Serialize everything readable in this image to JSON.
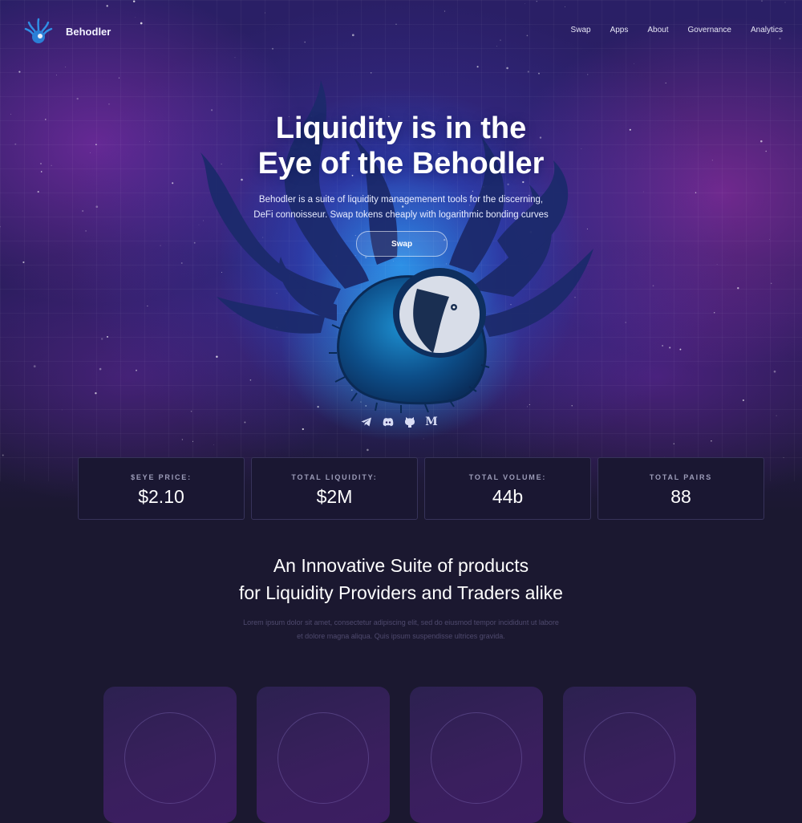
{
  "brand": {
    "name": "Behodler",
    "accent": "#1f78e0"
  },
  "nav": {
    "items": [
      "Swap",
      "Apps",
      "About",
      "Governance",
      "Analytics"
    ]
  },
  "hero": {
    "headline_line1": "Liquidity is in the",
    "headline_line2": "Eye of the Behodler",
    "subtext_line1": "Behodler is a suite of liquidity managemenent tools for the discerning,",
    "subtext_line2": "DeFi connoisseur. Swap tokens cheaply with logarithmic bonding curves",
    "cta_label": "Swap"
  },
  "socials": [
    {
      "name": "telegram-icon"
    },
    {
      "name": "discord-icon"
    },
    {
      "name": "github-icon"
    },
    {
      "name": "medium-icon",
      "glyph": "M"
    }
  ],
  "stats": [
    {
      "label": "$EYE PRICE:",
      "value": "$2.10"
    },
    {
      "label": "TOTAL LIQUIDITY:",
      "value": "$2M"
    },
    {
      "label": "TOTAL VOLUME:",
      "value": "44b"
    },
    {
      "label": "TOTAL PAIRS",
      "value": "88"
    }
  ],
  "section": {
    "title_line1": "An Innovative Suite of products",
    "title_line2": "for Liquidity Providers and Traders alike",
    "body_line1": "Lorem ipsum dolor sit amet, consectetur adipiscing elit, sed do eiusmod tempor incididunt ut labore",
    "body_line2": "et dolore magna aliqua. Quis ipsum suspendisse ultrices gravida."
  },
  "cards_count": 4
}
